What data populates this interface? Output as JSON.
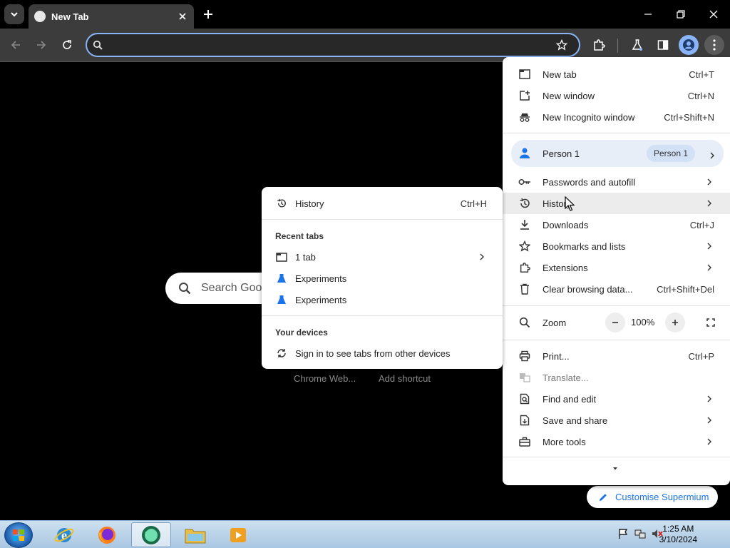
{
  "browser": {
    "tab_title": "New Tab",
    "omnibox_placeholder": ""
  },
  "ntp": {
    "search_placeholder": "Search Goo",
    "shortcuts": [
      "Chrome Web...",
      "Add shortcut"
    ],
    "customise_label": "Customise Supermium"
  },
  "main_menu": {
    "items_top": [
      {
        "label": "New tab",
        "shortcut": "Ctrl+T",
        "icon": "new-tab-icon"
      },
      {
        "label": "New window",
        "shortcut": "Ctrl+N",
        "icon": "new-window-icon"
      },
      {
        "label": "New Incognito window",
        "shortcut": "Ctrl+Shift+N",
        "icon": "incognito-icon"
      }
    ],
    "person": {
      "label": "Person 1",
      "badge": "Person 1"
    },
    "items_mid": [
      {
        "label": "Passwords and autofill",
        "shortcut": "",
        "icon": "key-icon"
      },
      {
        "label": "History",
        "shortcut": "",
        "icon": "history-icon"
      },
      {
        "label": "Downloads",
        "shortcut": "Ctrl+J",
        "icon": "download-icon"
      },
      {
        "label": "Bookmarks and lists",
        "shortcut": "",
        "icon": "star-icon"
      },
      {
        "label": "Extensions",
        "shortcut": "",
        "icon": "puzzle-icon"
      },
      {
        "label": "Clear browsing data...",
        "shortcut": "Ctrl+Shift+Del",
        "icon": "trash-icon"
      }
    ],
    "zoom": {
      "label": "Zoom",
      "value": "100%"
    },
    "items_bottom": [
      {
        "label": "Print...",
        "shortcut": "Ctrl+P",
        "icon": "print-icon"
      },
      {
        "label": "Translate...",
        "shortcut": "",
        "icon": "translate-icon"
      },
      {
        "label": "Find and edit",
        "shortcut": "",
        "icon": "find-icon"
      },
      {
        "label": "Save and share",
        "shortcut": "",
        "icon": "save-icon"
      },
      {
        "label": "More tools",
        "shortcut": "",
        "icon": "toolbox-icon"
      }
    ]
  },
  "history_menu": {
    "history": {
      "label": "History",
      "shortcut": "Ctrl+H"
    },
    "recent_tabs_heading": "Recent tabs",
    "recent": [
      {
        "label": "1 tab"
      },
      {
        "label": "Experiments"
      },
      {
        "label": "Experiments"
      }
    ],
    "devices_heading": "Your devices",
    "sign_in": "Sign in to see tabs from other devices"
  },
  "taskbar": {
    "time": "1:25 AM",
    "date": "3/10/2024"
  },
  "colors": {
    "accent": "#1a73e8",
    "toolbar": "#3c3c3c",
    "lab_icon": "#1a73e8"
  }
}
